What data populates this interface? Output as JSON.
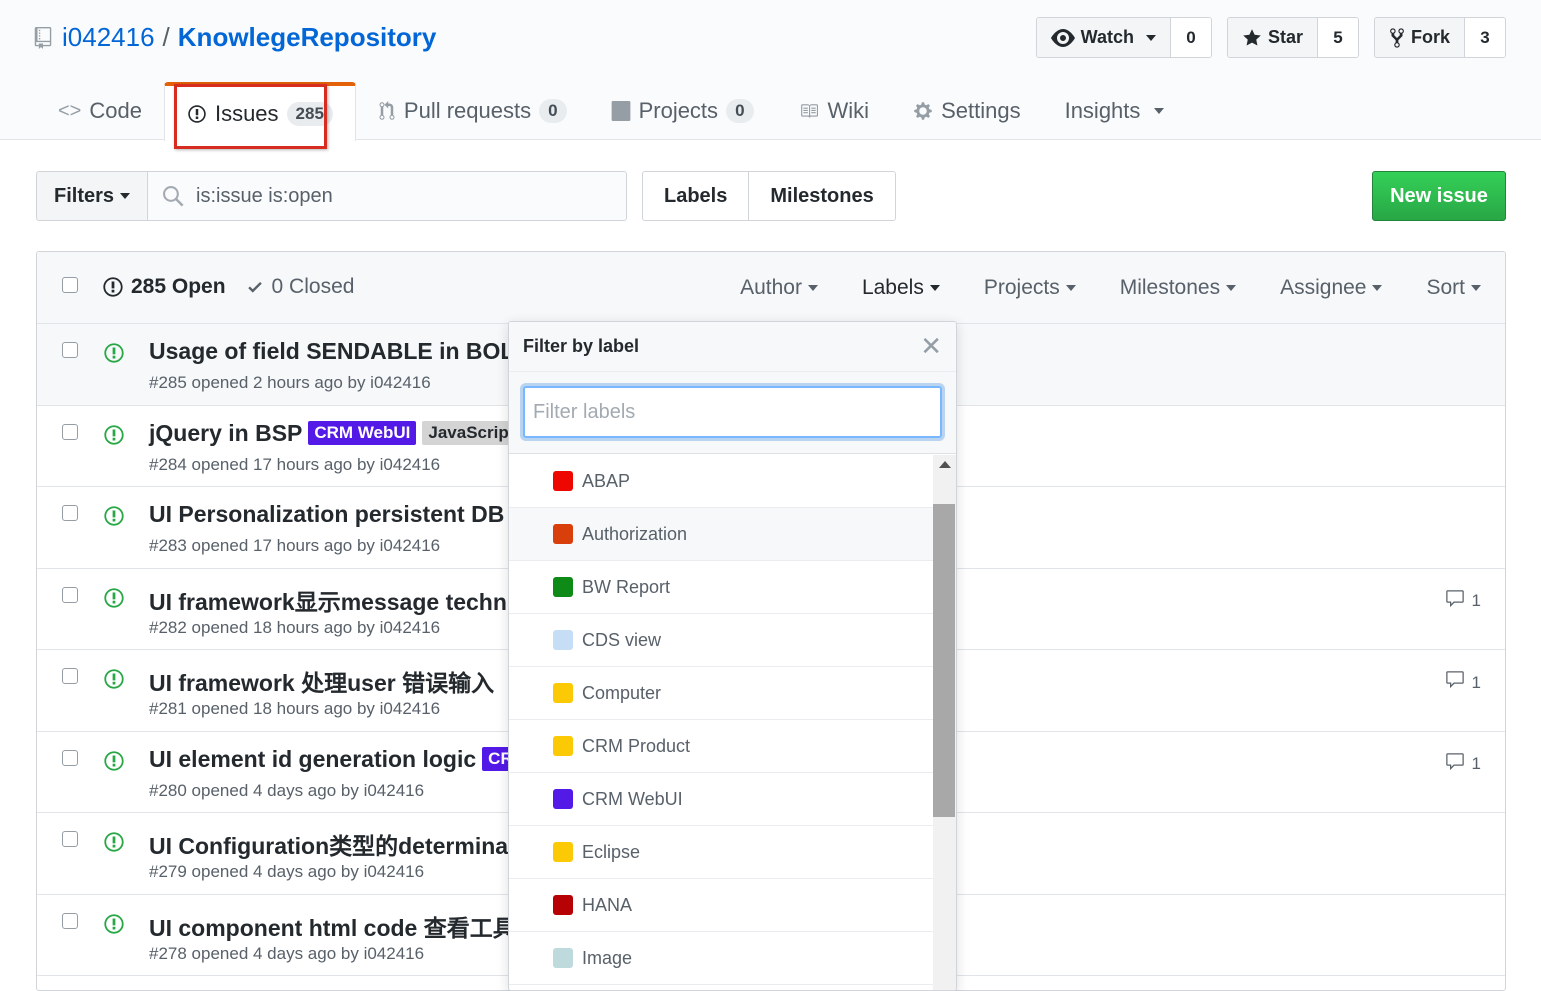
{
  "repo": {
    "owner": "i042416",
    "separator": "/",
    "name": "KnowlegeRepository"
  },
  "actions": [
    {
      "label": "Watch",
      "count": "0",
      "icon": "eye-icon"
    },
    {
      "label": "Star",
      "count": "5",
      "icon": "star-icon"
    },
    {
      "label": "Fork",
      "count": "3",
      "icon": "fork-icon"
    }
  ],
  "tabs": [
    {
      "label": "Code",
      "counter": "",
      "icon": "code-icon"
    },
    {
      "label": "Issues",
      "counter": "285",
      "icon": "issue-opened-icon"
    },
    {
      "label": "Pull requests",
      "counter": "0",
      "icon": "pull-request-icon"
    },
    {
      "label": "Projects",
      "counter": "0",
      "icon": "project-icon"
    },
    {
      "label": "Wiki",
      "counter": "",
      "icon": "book-icon"
    },
    {
      "label": "Settings",
      "counter": "",
      "icon": "gear-icon"
    },
    {
      "label": "Insights",
      "counter": "",
      "icon": ""
    }
  ],
  "subnav": {
    "filters_label": "Filters",
    "search_value": "is:issue is:open",
    "labels_label": "Labels",
    "milestones_label": "Milestones",
    "new_issue_label": "New issue"
  },
  "issues_header": {
    "open_label": "285 Open",
    "closed_label": "0 Closed",
    "menus": [
      "Author",
      "Labels",
      "Projects",
      "Milestones",
      "Assignee",
      "Sort"
    ]
  },
  "issues": [
    {
      "title": "Usage of field SENDABLE in BOL",
      "meta": "#285 opened 2 hours ago by i042416",
      "labels": [],
      "comments": ""
    },
    {
      "title": "jQuery in BSP",
      "meta": "#284 opened 17 hours ago by i042416",
      "labels": [
        {
          "name": "CRM WebUI",
          "bg": "#5319e7",
          "fg": "#ffffff"
        },
        {
          "name": "JavaScript",
          "bg": "#d4d4d4",
          "fg": "#24292e"
        }
      ],
      "comments": ""
    },
    {
      "title": "UI Personalization persistent DB",
      "meta": "#283 opened 17 hours ago by i042416",
      "labels": [],
      "comments": ""
    },
    {
      "title": "UI framework显示message techn",
      "meta": "#282 opened 18 hours ago by i042416",
      "labels": [],
      "comments": "1"
    },
    {
      "title": "UI framework 处理user 错误输入",
      "meta": "#281 opened 18 hours ago by i042416",
      "labels": [],
      "comments": "1"
    },
    {
      "title": "UI element id generation logic",
      "meta": "#280 opened 4 days ago by i042416",
      "labels": [
        {
          "name": "CRM WebUI",
          "bg": "#5319e7",
          "fg": "#ffffff"
        }
      ],
      "comments": "1"
    },
    {
      "title": "UI Configuration类型的determina",
      "meta": "#279 opened 4 days ago by i042416",
      "labels": [],
      "comments": ""
    },
    {
      "title": "UI component html code 查看工具",
      "meta": "#278 opened 4 days ago by i042416",
      "labels": [],
      "comments": ""
    }
  ],
  "label_dropdown": {
    "title": "Filter by label",
    "filter_placeholder": "Filter labels",
    "labels": [
      {
        "name": "ABAP",
        "color": "#ee0701"
      },
      {
        "name": "Authorization",
        "color": "#d93f0b"
      },
      {
        "name": "BW Report",
        "color": "#0e8a16"
      },
      {
        "name": "CDS view",
        "color": "#c5def5"
      },
      {
        "name": "Computer",
        "color": "#fbca04"
      },
      {
        "name": "CRM Product",
        "color": "#fbca04"
      },
      {
        "name": "CRM WebUI",
        "color": "#5319e7"
      },
      {
        "name": "Eclipse",
        "color": "#fbca04"
      },
      {
        "name": "HANA",
        "color": "#b60205"
      },
      {
        "name": "Image",
        "color": "#bfdadc"
      }
    ]
  }
}
